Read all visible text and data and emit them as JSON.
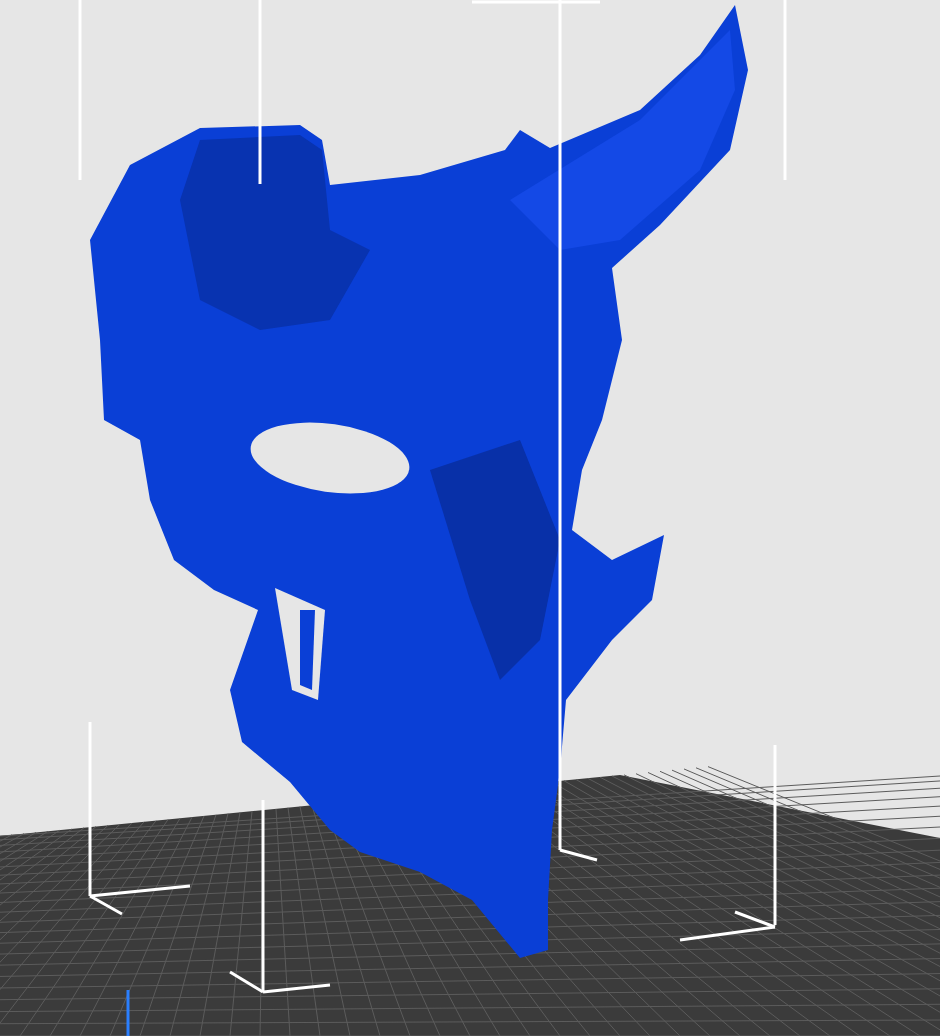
{
  "viewport": {
    "kind": "slicer-3d-view"
  }
}
